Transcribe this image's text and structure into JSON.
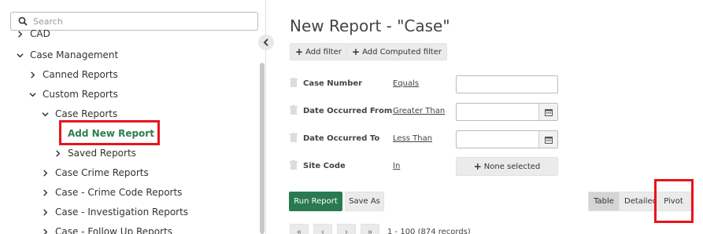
{
  "sidebar": {
    "search_placeholder": "Search",
    "tree": {
      "cad": "CAD",
      "case_management": "Case Management",
      "canned_reports": "Canned Reports",
      "custom_reports": "Custom Reports",
      "case_reports": "Case Reports",
      "add_new_report": "Add New Report",
      "saved_reports": "Saved Reports",
      "case_crime_reports": "Case Crime Reports",
      "case_crime_code_reports": "Case - Crime Code Reports",
      "case_investigation_reports": "Case - Investigation Reports",
      "case_follow_up_reports": "Case - Follow Up Reports"
    }
  },
  "main": {
    "title": "New Report - \"Case\"",
    "add_filter": "Add filter",
    "add_computed_filter": "Add Computed filter",
    "filters": [
      {
        "label": "Case Number",
        "operator": "Equals"
      },
      {
        "label": "Date Occurred From",
        "operator": "Greater Than"
      },
      {
        "label": "Date Occurred To",
        "operator": "Less Than"
      },
      {
        "label": "Site Code",
        "operator": "In",
        "value": "None selected"
      }
    ],
    "run_report": "Run Report",
    "save_as": "Save As",
    "views": {
      "table": "Table",
      "detailed": "Detailed",
      "pivot": "Pivot"
    },
    "pager": {
      "first": "«",
      "prev": "‹",
      "next": "›",
      "last": "»",
      "info": "1 - 100 (874 records)"
    }
  },
  "colors": {
    "accent_green": "#2a7a50",
    "highlight_red": "#e8141c",
    "active_node": "#2e7d4f"
  }
}
